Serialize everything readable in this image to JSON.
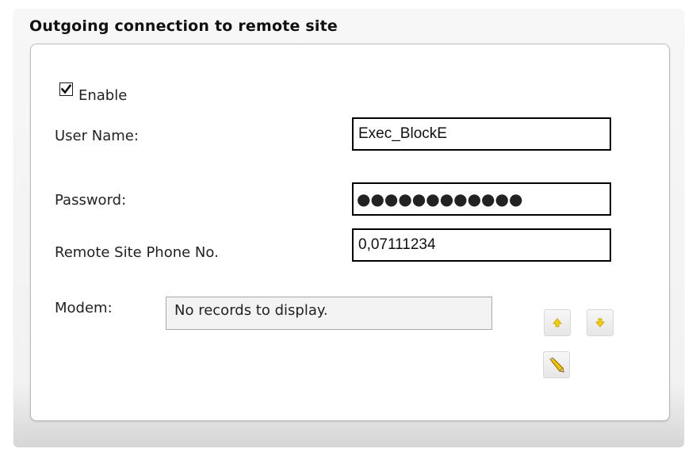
{
  "section": {
    "title": "Outgoing connection to remote site"
  },
  "enable": {
    "label": "Enable",
    "checked": true
  },
  "user_name": {
    "label": "User Name:",
    "value": "Exec_BlockE"
  },
  "password": {
    "label": "Password:",
    "masked": "●●●●●●●●●●●●"
  },
  "phone": {
    "label": "Remote Site Phone No.",
    "value": "0,07111234"
  },
  "modem": {
    "label": "Modem:",
    "list_text": "No records to display."
  },
  "icons": {
    "move_up": "arrow-up-icon",
    "move_down": "arrow-down-icon",
    "edit": "pencil-icon"
  },
  "colors": {
    "panel_bg": "#f2f2f2",
    "input_border": "#000000",
    "list_bg": "#f3f3f3",
    "icon_yellow": "#e8c400"
  }
}
